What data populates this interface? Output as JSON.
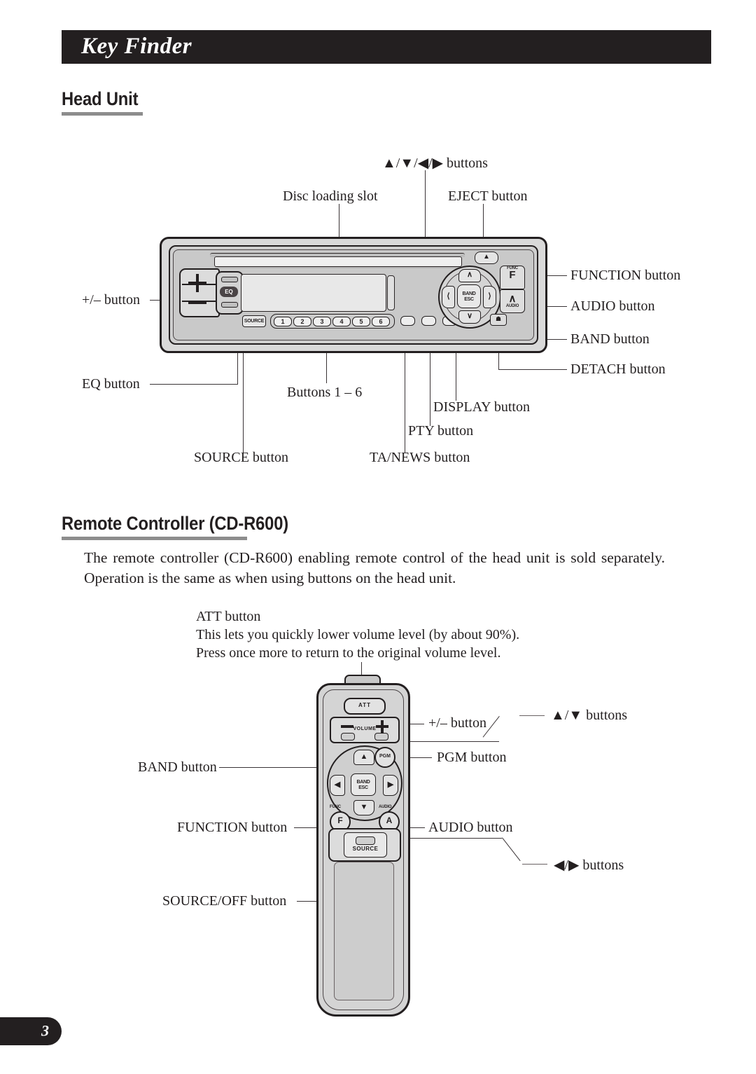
{
  "header": {
    "title": "Key Finder"
  },
  "sections": {
    "head_unit": {
      "heading": "Head Unit"
    },
    "remote": {
      "heading": "Remote Controller (CD-R600)",
      "paragraph": "The remote controller (CD-R600) enabling remote control of the head unit is sold separately. Operation is the same as when using buttons on the head unit."
    }
  },
  "head_unit_labels": {
    "arrow_buttons": "▲/▼/◀/▶ buttons",
    "disc_slot": "Disc loading slot",
    "eject": "EJECT button",
    "plus_minus": "+/– button",
    "eq": "EQ button",
    "function": "FUNCTION button",
    "audio": "AUDIO button",
    "band": "BAND button",
    "detach": "DETACH button",
    "source": "SOURCE button",
    "buttons_1_6": "Buttons 1 – 6",
    "ta_news": "TA/NEWS button",
    "pty": "PTY button",
    "display": "DISPLAY button"
  },
  "head_unit_face": {
    "presets": [
      "1",
      "2",
      "3",
      "4",
      "5",
      "6"
    ],
    "source_key": "SOURCE",
    "eq_key": "EQ",
    "dpad": {
      "up": "∧",
      "down": "∨",
      "left": "⟨",
      "right": "⟩",
      "center_line1": "BAND",
      "center_line2": "ESC"
    },
    "eject_key": "▲",
    "detach_key": "☗",
    "func_key": {
      "top": "FUNC",
      "glyph": "F"
    },
    "audio_key": {
      "glyph": "∧",
      "bottom": "AUDIO"
    }
  },
  "remote_notes": {
    "att_title": "ATT button",
    "att_line1": "This lets you quickly lower volume level (by about 90%).",
    "att_line2": "Press once more to return to the original volume level."
  },
  "remote_labels": {
    "plus_minus": "+/– button",
    "up_down": "▲/▼ buttons",
    "pgm": "PGM button",
    "band": "BAND button",
    "function": "FUNCTION button",
    "audio": "AUDIO button",
    "left_right": "◀/▶ buttons",
    "source_off": "SOURCE/OFF button"
  },
  "remote_face": {
    "att": "ATT",
    "volume": "VOLUME",
    "pgm": "PGM",
    "band_line1": "BAND",
    "band_line2": "ESC",
    "func_caption": "FUNC",
    "func_glyph": "F",
    "audio_caption": "AUDIO",
    "audio_glyph": "A",
    "source": "SOURCE",
    "up": "▲",
    "down": "▼",
    "left": "◀",
    "right": "▶"
  },
  "footer": {
    "page_number": "3"
  },
  "colors": {
    "ink": "#231f20",
    "rule": "#8d8d8d",
    "panel": "#d4d4d4"
  }
}
